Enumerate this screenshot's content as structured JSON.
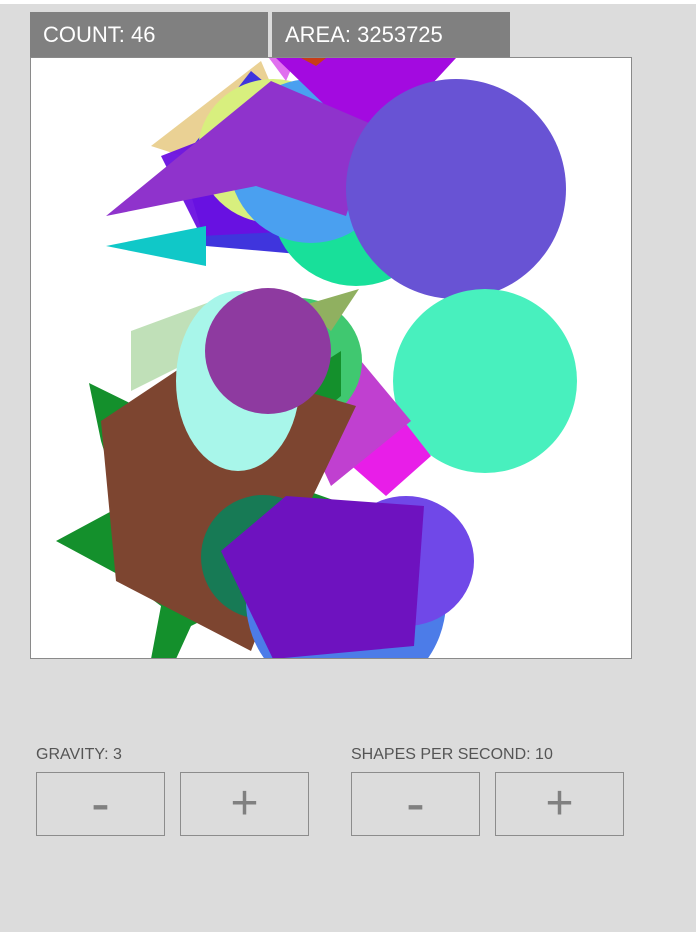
{
  "stats": {
    "count": "COUNT: 46",
    "area": "AREA: 3253725"
  },
  "controls": {
    "gravity_label": "GRAVITY: 3",
    "sps_label": "SHAPES PER SECOND: 10",
    "minus": "-",
    "plus": "+"
  },
  "colors": {
    "background": "#dcdcdc",
    "stat_bg": "#808080",
    "canvas_bg": "#ffffff"
  }
}
